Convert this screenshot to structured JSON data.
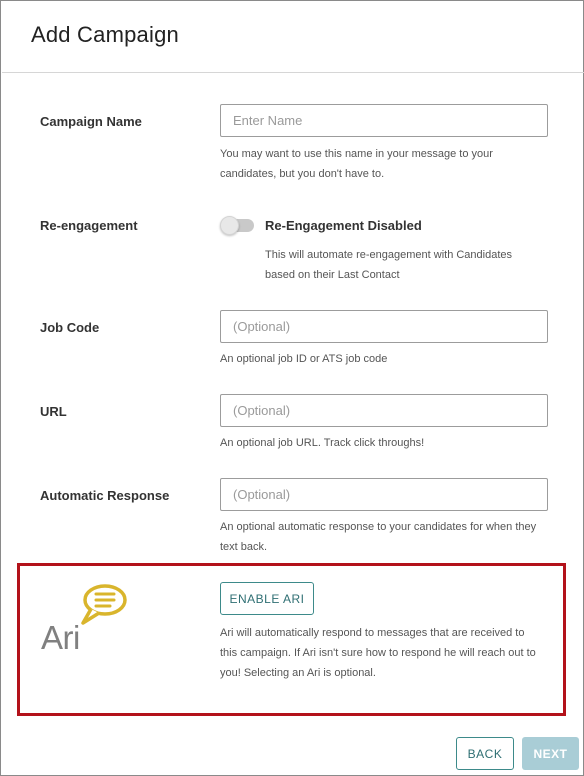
{
  "header": {
    "title": "Add Campaign"
  },
  "form": {
    "campaign_name": {
      "label": "Campaign Name",
      "placeholder": "Enter Name",
      "value": "",
      "help_line1": "You may want to use this name in your message to your",
      "help_line2": "candidates, but you don't have to."
    },
    "reengagement": {
      "label": "Re-engagement",
      "toggle_label": "Re-Engagement Disabled",
      "enabled": false,
      "help_line1": "This will automate re-engagement with Candidates",
      "help_line2": "based on their Last Contact"
    },
    "job_code": {
      "label": "Job Code",
      "placeholder": "(Optional)",
      "value": "",
      "help": "An optional job ID or ATS job code"
    },
    "url": {
      "label": "URL",
      "placeholder": "(Optional)",
      "value": "",
      "help": "An optional job URL. Track click throughs!"
    },
    "automatic_response": {
      "label": "Automatic Response",
      "placeholder": "(Optional)",
      "value": "",
      "help_line1": "An optional automatic response to your candidates for when they",
      "help_line2": "text back."
    }
  },
  "ari": {
    "logo_text": "Ari",
    "logo_icon": "chat-bubble-icon",
    "enable_label": "ENABLE ARI",
    "help_line1": "Ari will automatically respond to messages that are received to",
    "help_line2": "this campaign. If Ari isn't sure how to respond he will reach out to",
    "help_line3": "you! Selecting an Ari is optional."
  },
  "footer": {
    "back_label": "BACK",
    "next_label": "NEXT"
  },
  "colors": {
    "highlight_border": "#b3121a",
    "accent_teal": "#2f6f73",
    "next_disabled_bg": "#a9cdd6",
    "ari_bubble": "#d9b52c"
  }
}
